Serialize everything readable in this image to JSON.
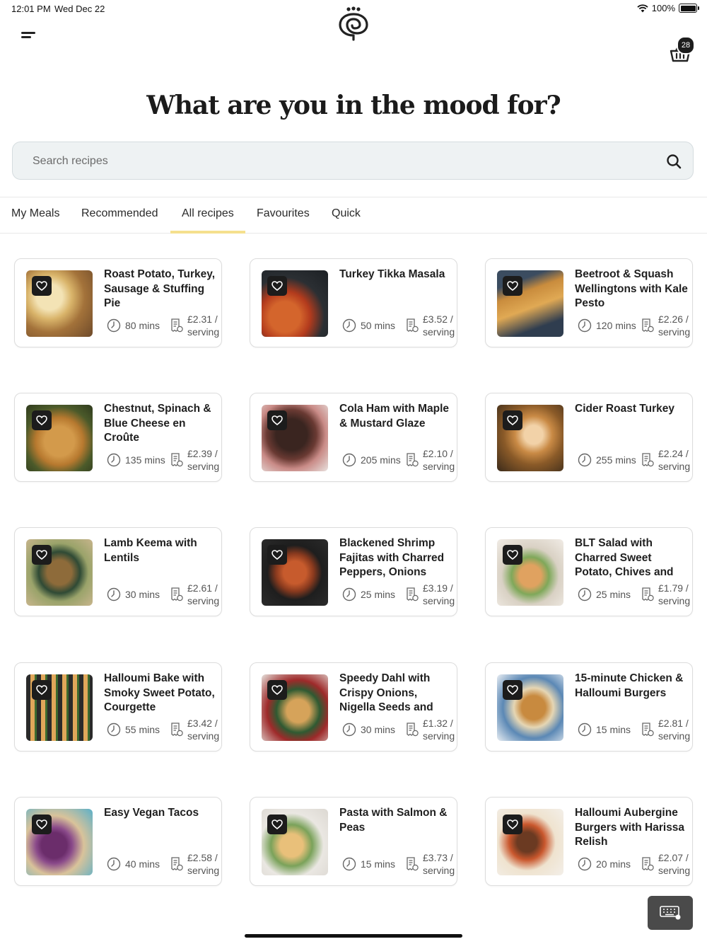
{
  "status": {
    "time": "12:01 PM",
    "date": "Wed Dec 22",
    "battery": "100%"
  },
  "header": {
    "basket_count": "28"
  },
  "page": {
    "title": "What are you in the mood for?"
  },
  "search": {
    "placeholder": "Search recipes"
  },
  "tabs": [
    {
      "label": "My Meals"
    },
    {
      "label": "Recommended"
    },
    {
      "label": "All recipes",
      "active": true
    },
    {
      "label": "Favourites"
    },
    {
      "label": "Quick"
    }
  ],
  "recipes": [
    {
      "title": "Roast Potato, Turkey, Sausage & Stuffing Pie",
      "time": "80 mins",
      "price": "£2.31 / serving"
    },
    {
      "title": "Turkey Tikka Masala",
      "time": "50 mins",
      "price": "£3.52 / serving"
    },
    {
      "title": "Beetroot & Squash Wellingtons with Kale Pesto",
      "time": "120 mins",
      "price": "£2.26 / serving"
    },
    {
      "title": "Chestnut, Spinach & Blue Cheese en Croûte",
      "time": "135 mins",
      "price": "£2.39 / serving"
    },
    {
      "title": "Cola Ham with Maple & Mustard Glaze",
      "time": "205 mins",
      "price": "£2.10 / serving"
    },
    {
      "title": "Cider Roast Turkey",
      "time": "255 mins",
      "price": "£2.24 / serving"
    },
    {
      "title": "Lamb Keema with Lentils",
      "time": "30 mins",
      "price": "£2.61 / serving"
    },
    {
      "title": "Blackened Shrimp Fajitas with Charred Peppers, Onions",
      "time": "25 mins",
      "price": "£3.19 / serving"
    },
    {
      "title": "BLT Salad with Charred Sweet Potato, Chives and",
      "time": "25 mins",
      "price": "£1.79 / serving"
    },
    {
      "title": "Halloumi Bake with Smoky Sweet Potato, Courgette",
      "time": "55 mins",
      "price": "£3.42 / serving"
    },
    {
      "title": "Speedy Dahl with Crispy Onions, Nigella Seeds and",
      "time": "30 mins",
      "price": "£1.32 / serving"
    },
    {
      "title": "15-minute Chicken & Halloumi Burgers",
      "time": "15 mins",
      "price": "£2.81 / serving"
    },
    {
      "title": "Easy Vegan Tacos",
      "time": "40 mins",
      "price": "£2.58 / serving"
    },
    {
      "title": "Pasta with Salmon & Peas",
      "time": "15 mins",
      "price": "£3.73 / serving"
    },
    {
      "title": "Halloumi Aubergine Burgers with Harissa Relish",
      "time": "20 mins",
      "price": "£2.07 / serving"
    }
  ]
}
